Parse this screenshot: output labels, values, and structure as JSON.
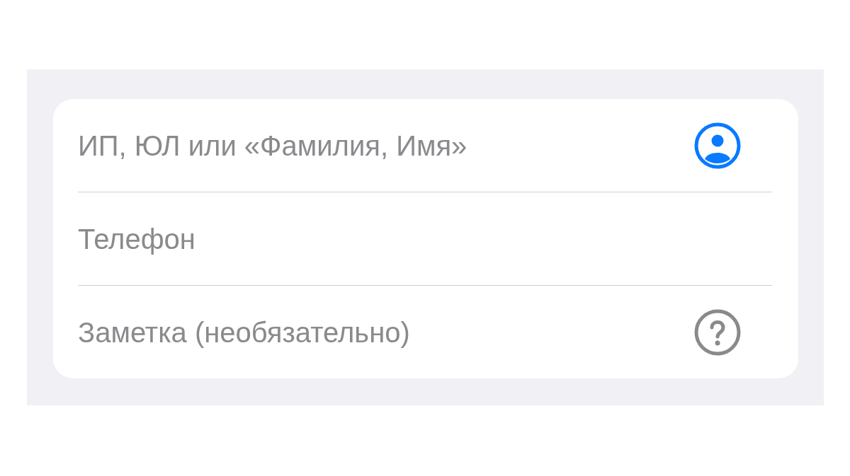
{
  "form": {
    "fields": [
      {
        "placeholder": "ИП, ЮЛ или «Фамилия, Имя»",
        "kind": "contact"
      },
      {
        "placeholder": "Телефон",
        "kind": "plain"
      },
      {
        "placeholder": "Заметка (необязательно)",
        "kind": "help"
      }
    ]
  }
}
